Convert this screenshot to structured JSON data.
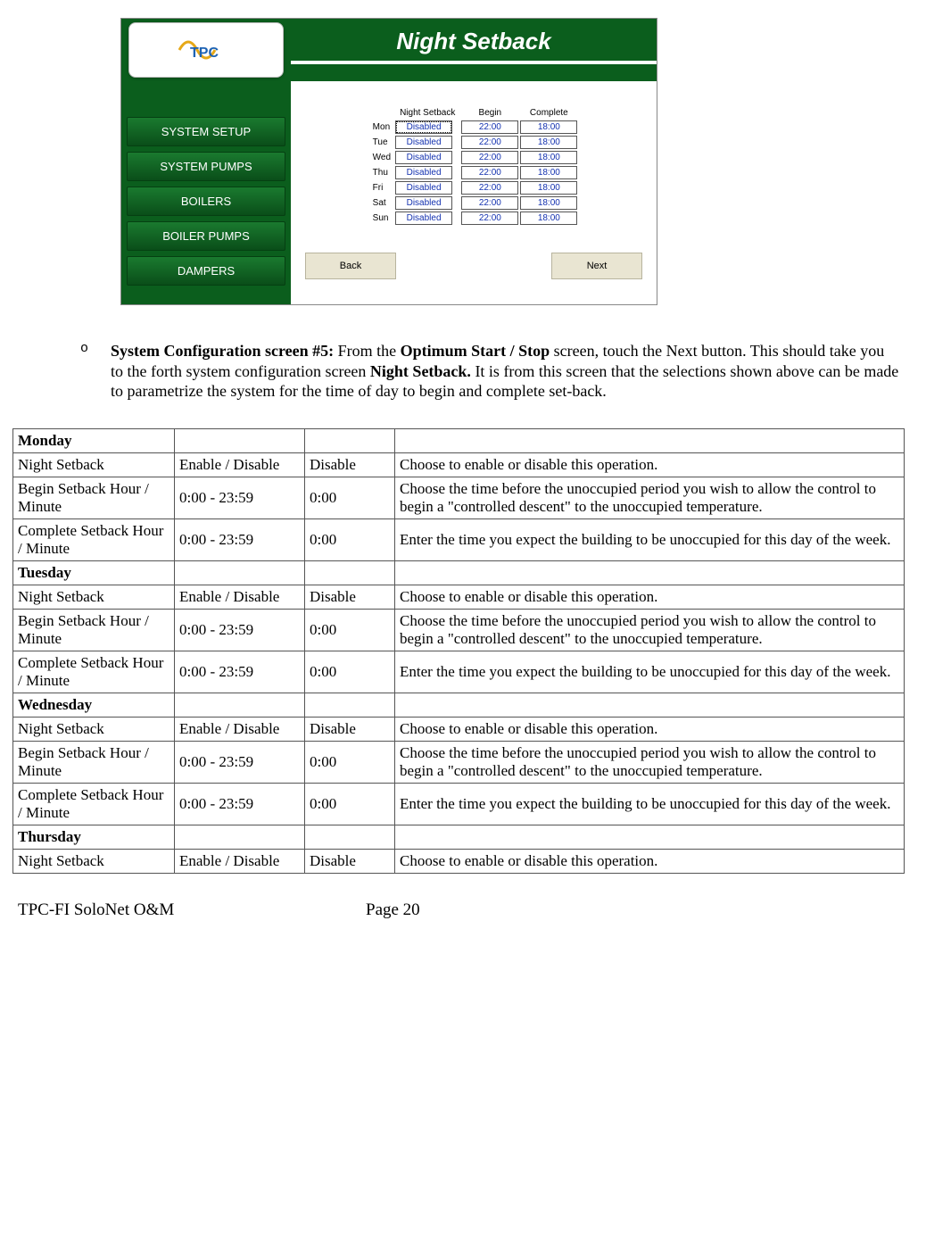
{
  "screenshot": {
    "title": "Night Setback",
    "logo_text": "TPC",
    "sidebar": [
      "SYSTEM SETUP",
      "SYSTEM PUMPS",
      "BOILERS",
      "BOILER PUMPS",
      "DAMPERS"
    ],
    "grid_headers": [
      "Night Setback",
      "Begin",
      "Complete"
    ],
    "rows": [
      {
        "day": "Mon",
        "ns": "Disabled",
        "begin": "22:00",
        "complete": "18:00",
        "sel": true
      },
      {
        "day": "Tue",
        "ns": "Disabled",
        "begin": "22:00",
        "complete": "18:00"
      },
      {
        "day": "Wed",
        "ns": "Disabled",
        "begin": "22:00",
        "complete": "18:00"
      },
      {
        "day": "Thu",
        "ns": "Disabled",
        "begin": "22:00",
        "complete": "18:00"
      },
      {
        "day": "Fri",
        "ns": "Disabled",
        "begin": "22:00",
        "complete": "18:00"
      },
      {
        "day": "Sat",
        "ns": "Disabled",
        "begin": "22:00",
        "complete": "18:00"
      },
      {
        "day": "Sun",
        "ns": "Disabled",
        "begin": "22:00",
        "complete": "18:00"
      }
    ],
    "back": "Back",
    "next": "Next"
  },
  "doc": {
    "bullet": "o",
    "lead_bold1": "System Configuration screen #5:",
    "lead_bold2": "Optimum Start / Stop",
    "lead_bold3": "Night Setback.",
    "t1": "  From the ",
    "t2": " screen, touch the Next button.  This should take you to the forth system configuration screen ",
    "t3": "  It is from this screen that the selections shown above can be made to parametrize the system for the time of day to begin and complete set-back."
  },
  "table": {
    "days": [
      {
        "name": "Monday",
        "rows": [
          {
            "c1": "Night Setback",
            "c2": "Enable / Disable",
            "c3": "Disable",
            "c4": "Choose to enable or disable this operation."
          },
          {
            "c1": "Begin Setback Hour / Minute",
            "c2": "0:00 - 23:59",
            "c3": "0:00",
            "c4": "Choose the time before the unoccupied period you wish to allow the control to begin a \"controlled descent\" to the unoccupied temperature."
          },
          {
            "c1": "Complete Setback Hour / Minute",
            "c2": "0:00 - 23:59",
            "c3": "0:00",
            "c4": "Enter the time you expect the building to be unoccupied for this day of the week."
          }
        ]
      },
      {
        "name": "Tuesday",
        "rows": [
          {
            "c1": "Night Setback",
            "c2": "Enable / Disable",
            "c3": "Disable",
            "c4": "Choose to enable or disable this operation."
          },
          {
            "c1": "Begin Setback Hour / Minute",
            "c2": "0:00 - 23:59",
            "c3": "0:00",
            "c4": "Choose the time before the unoccupied period you wish to allow the control to begin a \"controlled descent\" to the unoccupied temperature."
          },
          {
            "c1": "Complete Setback Hour / Minute",
            "c2": "0:00 - 23:59",
            "c3": "0:00",
            "c4": "Enter the time you expect the building to be unoccupied for this day of the week."
          }
        ]
      },
      {
        "name": "Wednesday",
        "rows": [
          {
            "c1": "Night Setback",
            "c2": "Enable / Disable",
            "c3": "Disable",
            "c4": "Choose to enable or disable this operation."
          },
          {
            "c1": "Begin Setback Hour / Minute",
            "c2": "0:00 - 23:59",
            "c3": "0:00",
            "c4": "Choose the time before the unoccupied period you wish to allow the control to begin a \"controlled descent\" to the unoccupied temperature."
          },
          {
            "c1": "Complete Setback Hour / Minute",
            "c2": "0:00 - 23:59",
            "c3": "0:00",
            "c4": "Enter the time you expect the building to be unoccupied for this day of the week."
          }
        ]
      },
      {
        "name": "Thursday",
        "rows": [
          {
            "c1": "Night Setback",
            "c2": "Enable / Disable",
            "c3": "Disable",
            "c4": "Choose to enable or disable this operation."
          }
        ]
      }
    ]
  },
  "footer": {
    "left": "TPC-FI SoloNet O&M",
    "page": "Page 20"
  }
}
